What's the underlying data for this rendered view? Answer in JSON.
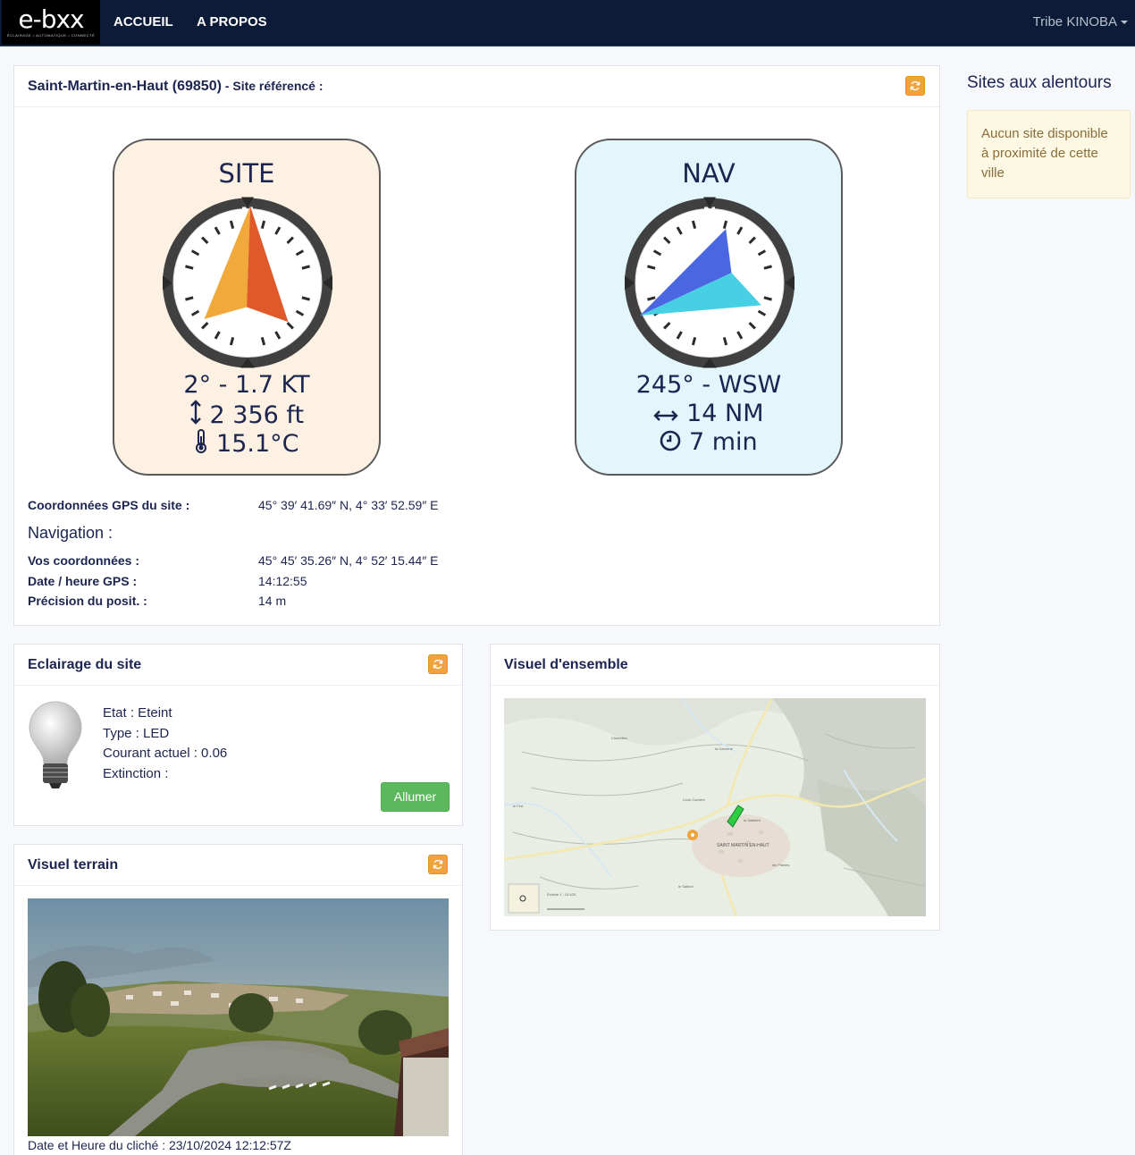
{
  "navbar": {
    "logo_text": "e-bxx",
    "logo_tagline": "ÉCLAIRAGE • AUTOMATIQUE • CONNECTÉ",
    "links": [
      "ACCUEIL",
      "A PROPOS"
    ],
    "user": "Tribe KINOBA"
  },
  "site_panel": {
    "site_name": "Saint-Martin-en-Haut (69850)",
    "status": " - Site référencé :",
    "site_card": {
      "title": "SITE",
      "north": "N",
      "wind": "2° - 1.7 KT",
      "altitude": "2 356 ft",
      "temperature": "15.1°C",
      "arrow_heading_deg": 2
    },
    "nav_card": {
      "title": "NAV",
      "north": "N",
      "bearing": "245° - WSW",
      "distance": "14 NM",
      "duration": "7 min",
      "arrow_heading_deg": 245
    },
    "gps_label": "Coordonnées GPS du site :",
    "gps_value": "45° 39′ 41.69″ N, 4° 33′ 52.59″ E",
    "navigation_heading": "Navigation :",
    "coords_label": "Vos coordonnées :",
    "coords_value": "45° 45′ 35.26″ N, 4° 52′ 15.44″ E",
    "datetime_label": "Date / heure GPS :",
    "datetime_value": "14:12:55",
    "precision_label": "Précision du posit. :",
    "precision_value": "14 m"
  },
  "side": {
    "title": "Sites aux alentours",
    "alert": "Aucun site disponible à proximité de cette ville"
  },
  "lighting_panel": {
    "title": "Eclairage du site",
    "state": "Etat : Eteint",
    "type": "Type : LED",
    "current": "Courant actuel : 0.06",
    "extinction": "Extinction :",
    "button": "Allumer"
  },
  "terrain_panel": {
    "title": "Visuel terrain",
    "caption": "Date et Heure du cliché : 23/10/2024 12:12:57Z"
  },
  "overview_panel": {
    "title": "Visuel d'ensemble",
    "map_town": "SAINT MARTIN EN-HAUT",
    "map_places": [
      "Croix Carrière",
      "la Sablière",
      "les Plaines",
      "le Sablon",
      "le Fort",
      "la Garonne",
      "Chazelles"
    ],
    "map_scale": "Échelle 1 : 15 625"
  },
  "colors": {
    "navbar": "#0c1c38",
    "site_card": "#fdf1e3",
    "nav_card": "#e2f6fb",
    "refresh": "#f0a33b",
    "button_green": "#5cb85c"
  }
}
